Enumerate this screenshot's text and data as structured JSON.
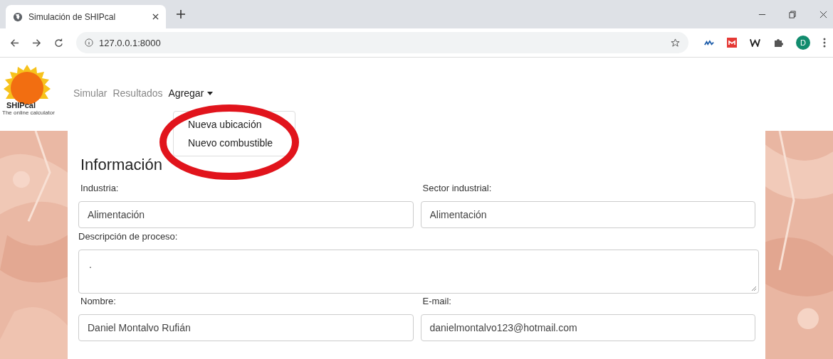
{
  "browser": {
    "tab_title": "Simulación de SHIPcal",
    "address": "127.0.0.1:8000",
    "profile_initial": "D"
  },
  "logo": {
    "name": "SHIPcal",
    "tagline": "The online calculator"
  },
  "nav": [
    {
      "label": "Simular",
      "selected": false
    },
    {
      "label": "Resultados",
      "selected": false
    },
    {
      "label": "Agregar",
      "selected": true
    }
  ],
  "dropdown": {
    "items": [
      "Nueva ubicación",
      "Nuevo combustible"
    ]
  },
  "heading": "Información",
  "form": {
    "fields": [
      {
        "label": "Industria:",
        "value": "Alimentación",
        "kind": "input"
      },
      {
        "label": "Sector industrial:",
        "value": "Alimentación",
        "kind": "input"
      },
      {
        "label": "Descripción de proceso:",
        "value": ".",
        "kind": "textarea"
      },
      {
        "label": "Nombre:",
        "value": "Daniel Montalvo Rufián",
        "kind": "input"
      },
      {
        "label": "E-mail:",
        "value": "danielmontalvo123@hotmail.com",
        "kind": "input"
      }
    ]
  }
}
